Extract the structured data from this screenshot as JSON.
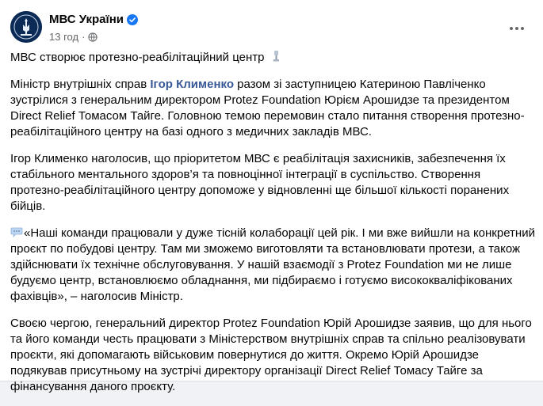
{
  "post": {
    "author": "МВС України",
    "time": "13 год",
    "separator": "·",
    "title": "МВС створює протезно-реабілітаційний центр",
    "title_emoji": "prosthetic-leg-emoji",
    "p1": {
      "before": "Міністр внутрішніх справ ",
      "mention": "Ігор Клименко",
      "after": " разом зі заступницею Катериною Павліченко зустрілися з генеральним директором Protez Foundation Юрієм Арошидзе та президентом Direct Relief Томасом Тайге. Головною темою перемовин стало питання створення протезно-реабілітаційного центру на базі одного з медичних закладів МВС."
    },
    "p2": "Ігор Клименко наголосив, що пріоритетом МВС є реабілітація захисників, забезпечення їх стабільного ментального здоров’я та повноцінної інтеграції в суспільство. Створення протезно-реабілітаційного центру допоможе у відновленні ще більшої кількості поранених бійців.",
    "p3": "«Наші команди працювали у дуже тісній колаборації цей рік. І ми вже вийшли на конкретний проєкт по побудові центру. Там ми зможемо виготовляти та встановлювати протези, а також здійснювати їх технічне обслуговування. У нашій взаємодії з Protez Foundation ми не лише будуємо центр, встановлюємо обладнання, ми підбираємо і готуємо висококваліфікованих фахівців», – наголосив Міністр.",
    "p3_emoji": "speech-bubble-emoji",
    "p4": "Своєю чергою, генеральний директор Protez Foundation Юрій Арошидзе заявив, що для нього та його команди честь працювати з Міністерством внутрішніх справ та спільно реалізовувати проєкти, які допомагають військовим повернутися до життя. Окремо Юрій Арошидзе подякував присутньому на зустрічі директору організації Direct Relief Томасу Тайге за фінансування даного проєкту."
  },
  "colors": {
    "link": "#385898",
    "verified": "#1877f2",
    "secondary_text": "#65676b",
    "avatar_bg": "#0b2a55"
  }
}
